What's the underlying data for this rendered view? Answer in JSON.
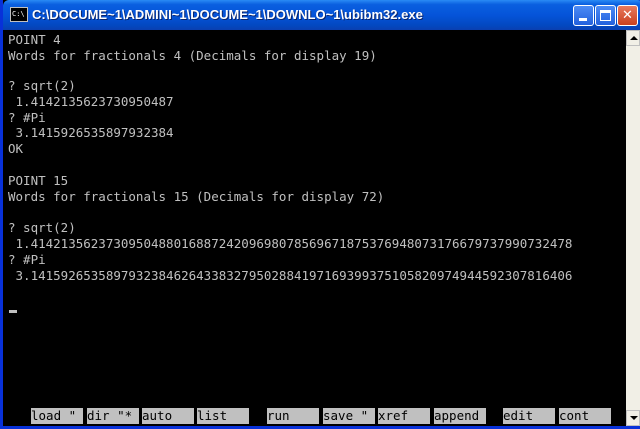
{
  "window": {
    "title": "C:\\DOCUME~1\\ADMINI~1\\DOCUME~1\\DOWNLO~1\\ubibm32.exe",
    "icon": "console-icon",
    "icon_text": "C:\\",
    "controls": [
      "minimize-icon",
      "maximize-icon",
      "close-icon"
    ],
    "close_glyph": "✕"
  },
  "console": {
    "lines": [
      "POINT 4",
      "Words for fractionals 4 (Decimals for display 19)",
      "",
      "? sqrt(2)",
      " 1.4142135623730950487",
      "? #Pi",
      " 3.1415926535897932384",
      "OK",
      "",
      "POINT 15",
      "Words for fractionals 15 (Decimals for display 72)",
      "",
      "? sqrt(2)",
      " 1.414213562373095048801688724209698078569671875376948073176679737990732478",
      "? #Pi",
      " 3.141592653589793238462643383279502884197169399375105820974944592307816406"
    ],
    "cursor": "_"
  },
  "function_keys": [
    {
      "label": "load \""
    },
    {
      "label": "dir \"*"
    },
    {
      "label": "auto"
    },
    {
      "label": "list"
    },
    {
      "label": "run"
    },
    {
      "label": "save \""
    },
    {
      "label": "xref"
    },
    {
      "label": "append"
    },
    {
      "label": "edit"
    },
    {
      "label": "cont"
    }
  ],
  "colors": {
    "titlebar": "#0554d9",
    "console_bg": "#000000",
    "console_text": "#c0c0c0",
    "fkey_bg": "#c0c0c0",
    "fkey_text": "#000000"
  }
}
